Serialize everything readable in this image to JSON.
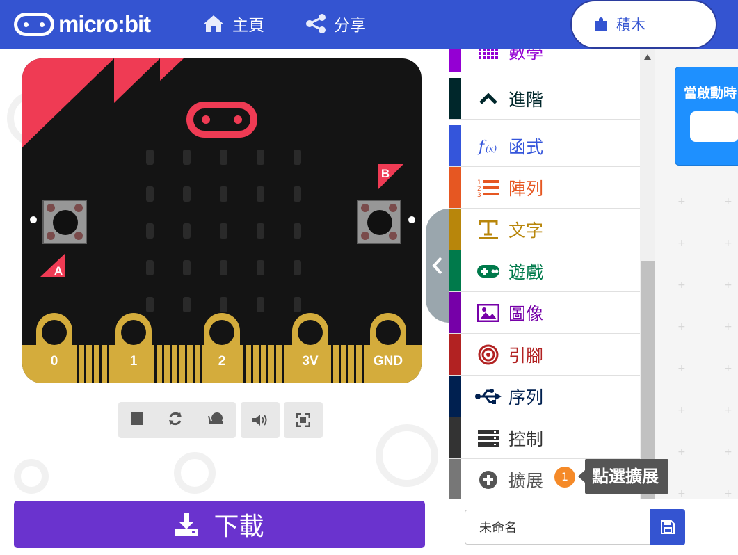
{
  "header": {
    "logo_text": "micro:bit",
    "nav_home": "主頁",
    "nav_share": "分享",
    "blocks_tab": "積木"
  },
  "simulator": {
    "buttons": {
      "a": "A",
      "b": "B"
    },
    "pins": [
      "0",
      "1",
      "2",
      "3V",
      "GND"
    ],
    "controls": [
      "stop-icon",
      "restart-icon",
      "slow-mo-icon",
      "mute-icon",
      "fullscreen-icon"
    ]
  },
  "toolbox": {
    "categories": [
      {
        "label": "數學",
        "color": "#9400d3",
        "icon": "grid-icon"
      },
      {
        "label": "進階",
        "color": "#00272b",
        "icon": "chevron-up-icon"
      },
      {
        "label": "函式",
        "color": "#3455db",
        "icon": "function-icon"
      },
      {
        "label": "陣列",
        "color": "#e65722",
        "icon": "list-icon"
      },
      {
        "label": "文字",
        "color": "#b8860b",
        "icon": "text-icon"
      },
      {
        "label": "遊戲",
        "color": "#007a4b",
        "icon": "gamepad-icon"
      },
      {
        "label": "圖像",
        "color": "#7600a8",
        "icon": "image-icon"
      },
      {
        "label": "引腳",
        "color": "#b22222",
        "icon": "target-icon"
      },
      {
        "label": "序列",
        "color": "#002050",
        "icon": "usb-icon"
      },
      {
        "label": "控制",
        "color": "#333333",
        "icon": "server-icon"
      },
      {
        "label": "擴展",
        "color": "#777777",
        "icon": "plus-circle-icon"
      }
    ]
  },
  "workspace": {
    "block_label": "當啟動時"
  },
  "tooltip": {
    "badge": "1",
    "text": "點選擴展"
  },
  "footer": {
    "download_label": "下載",
    "project_name": "未命名"
  }
}
